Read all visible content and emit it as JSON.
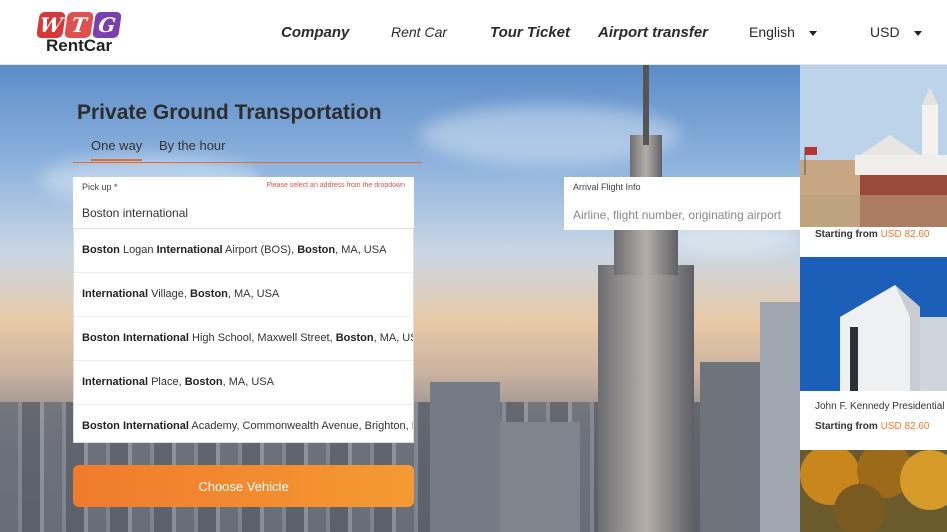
{
  "brand": {
    "letters": [
      "W",
      "T",
      "G"
    ],
    "name": "RentCar"
  },
  "nav": {
    "company": "Company",
    "rent_car": "Rent Car",
    "tour_ticket": "Tour Ticket",
    "airport_transfer": "Airport transfer",
    "language": "English",
    "currency": "USD"
  },
  "booking": {
    "title": "Private Ground Transportation",
    "tabs": [
      "One way",
      "By the hour"
    ],
    "pickup": {
      "label": "Pick up *",
      "error": "Please select an address from the dropdown",
      "value": "Boston international"
    },
    "flight": {
      "label": "Arrival Flight Info",
      "placeholder": "Airline, flight number, originating airport"
    },
    "suggestions": [
      [
        {
          "t": "Boston",
          "b": true
        },
        {
          "t": " Logan ",
          "b": false
        },
        {
          "t": "International",
          "b": true
        },
        {
          "t": " Airport (BOS), ",
          "b": false
        },
        {
          "t": "Boston",
          "b": true
        },
        {
          "t": ", MA, USA",
          "b": false
        }
      ],
      [
        {
          "t": "International",
          "b": true
        },
        {
          "t": " Village, ",
          "b": false
        },
        {
          "t": "Boston",
          "b": true
        },
        {
          "t": ", MA, USA",
          "b": false
        }
      ],
      [
        {
          "t": "Boston International",
          "b": true
        },
        {
          "t": " High School, Maxwell Street, ",
          "b": false
        },
        {
          "t": "Boston",
          "b": true
        },
        {
          "t": ", MA, USA",
          "b": false
        }
      ],
      [
        {
          "t": "International",
          "b": true
        },
        {
          "t": " Place, ",
          "b": false
        },
        {
          "t": "Boston",
          "b": true
        },
        {
          "t": ", MA, USA",
          "b": false
        }
      ],
      [
        {
          "t": "Boston International",
          "b": true
        },
        {
          "t": " Academy, Commonwealth Avenue, Brighton, MA, USA",
          "b": false
        }
      ]
    ],
    "choose_button": "Choose Vehicle"
  },
  "cards": [
    {
      "name": "",
      "starting_label": "Starting from",
      "price": "USD 82.60"
    },
    {
      "name": "John F. Kennedy Presidential Library",
      "starting_label": "Starting from",
      "price": "USD 82.60"
    },
    {
      "name": "",
      "starting_label": "",
      "price": ""
    }
  ],
  "colors": {
    "accent": "#f07a2c",
    "error": "#e0504f",
    "logo_red": "#d93838",
    "logo_purple": "#7b3fb0"
  }
}
